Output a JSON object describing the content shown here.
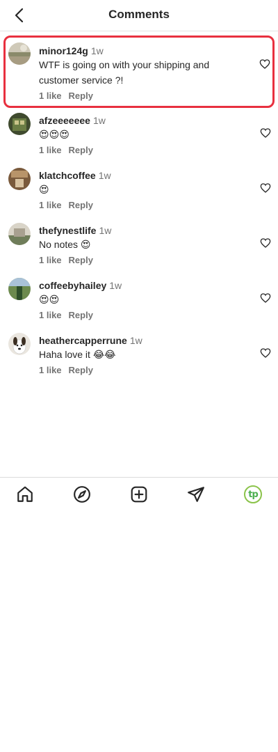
{
  "header": {
    "title": "Comments"
  },
  "comments": [
    {
      "username": "minor124g",
      "time": "1w",
      "text": "WTF is going on with your shipping and customer service ?!",
      "likes": "1 like",
      "reply": "Reply"
    },
    {
      "username": "afzeeeeeee",
      "time": "1w",
      "text": "😍😍😍",
      "likes": "1 like",
      "reply": "Reply"
    },
    {
      "username": "klatchcoffee",
      "time": "1w",
      "text": "😍",
      "likes": "1 like",
      "reply": "Reply"
    },
    {
      "username": "thefynestlife",
      "time": "1w",
      "text": "No notes 😍",
      "likes": "1 like",
      "reply": "Reply"
    },
    {
      "username": "coffeebyhailey",
      "time": "1w",
      "text": "😍😍",
      "likes": "1 like",
      "reply": "Reply"
    },
    {
      "username": "heathercapperrune",
      "time": "1w",
      "text": "Haha love it 😂😂",
      "likes": "1 like",
      "reply": "Reply"
    }
  ],
  "nav": [
    "home-icon",
    "explore-icon",
    "create-icon",
    "direct-icon",
    "profile-icon"
  ],
  "profile_badge": "tp",
  "colors": {
    "highlight": "#e8303f",
    "meta": "#737373"
  }
}
